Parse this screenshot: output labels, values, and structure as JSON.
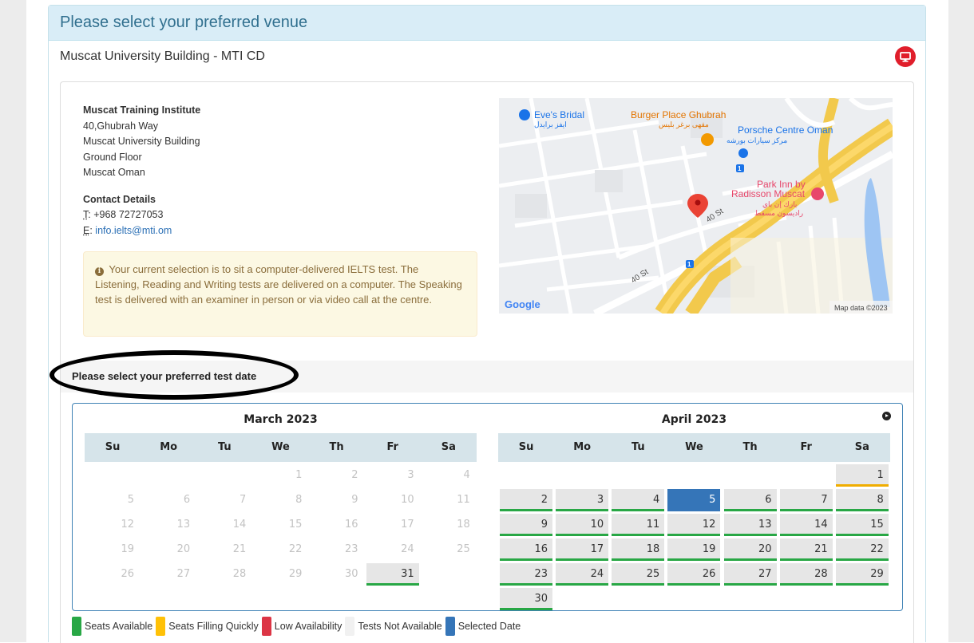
{
  "page_heading": "Please select your preferred venue",
  "venue": {
    "name": "Muscat University Building - MTI CD",
    "icon": "computer-monitor-icon",
    "icon_color": "#e01e2b"
  },
  "address": {
    "org": "Muscat Training Institute",
    "line1": "40,Ghubrah Way",
    "line2": "Muscat University Building",
    "line3": "Ground Floor",
    "line4": "Muscat Oman",
    "contact_title": "Contact Details",
    "phone_abbr": "T",
    "phone": ": +968 72727053",
    "email_abbr": "E",
    "email_sep": ": ",
    "email": "info.ielts@mti.om"
  },
  "notice": {
    "text": "Your current selection is to sit a computer-delivered IELTS test. The Listening, Reading and Writing tests are delivered on a computer. The Speaking test is delivered with an examiner in person or via video call at the centre."
  },
  "map": {
    "labels": {
      "eves_bridal": "Eve's Bridal",
      "eves_bridal_ar": "ايفز برايدل",
      "burger_place": "Burger Place Ghubrah",
      "burger_place_ar": "مقهى برغر بليس",
      "porsche": "Porsche Centre Oman",
      "porsche_ar": "مركز سيارات بورشه",
      "park_inn_1": "Park Inn by",
      "park_inn_2": "Radisson Muscat",
      "park_inn_ar1": "بارك إن باي",
      "park_inn_ar2": "راديسون مسقط",
      "road_a": "40 St",
      "road_b": "40 St",
      "route_1": "1",
      "route_2": "1",
      "google": "Google",
      "attribution": "Map data ©2023"
    }
  },
  "date_section": {
    "title": "Please select your preferred test date"
  },
  "calendar": {
    "weekday_labels": [
      "Su",
      "Mo",
      "Tu",
      "We",
      "Th",
      "Fr",
      "Sa"
    ],
    "months": [
      {
        "title": "March 2023",
        "first_weekday": 3,
        "days": 31,
        "available": [
          31
        ],
        "filling": [],
        "selected": null
      },
      {
        "title": "April 2023",
        "first_weekday": 6,
        "days": 30,
        "available": [
          2,
          3,
          4,
          6,
          7,
          8,
          9,
          10,
          11,
          12,
          13,
          14,
          15,
          16,
          17,
          18,
          19,
          20,
          21,
          22,
          23,
          24,
          25,
          26,
          27,
          28,
          29,
          30
        ],
        "filling": [
          1
        ],
        "selected": 5
      }
    ]
  },
  "legend": [
    {
      "label": "Seats Available",
      "color": "#28a745"
    },
    {
      "label": "Seats Filling Quickly",
      "color": "#ffc107"
    },
    {
      "label": "Low Availability",
      "color": "#dc3545"
    },
    {
      "label": "Tests Not Available",
      "color": "#f1f1f1"
    },
    {
      "label": "Selected Date",
      "color": "#3575b8"
    }
  ]
}
